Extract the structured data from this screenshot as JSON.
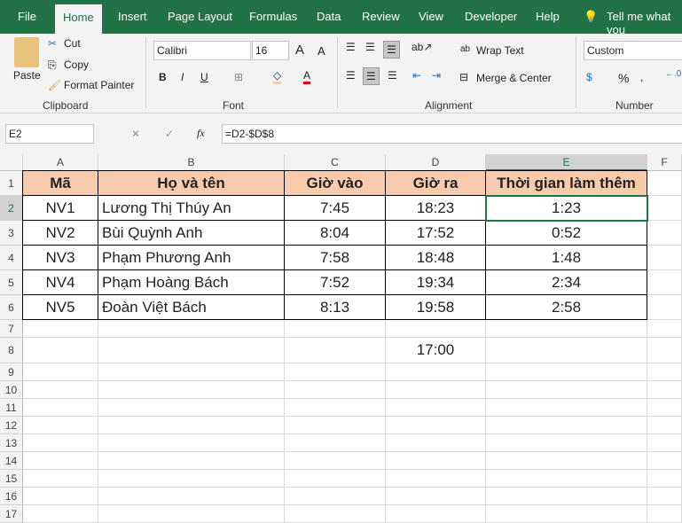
{
  "tabs": [
    "File",
    "Home",
    "Insert",
    "Page Layout",
    "Formulas",
    "Data",
    "Review",
    "View",
    "Developer",
    "Help"
  ],
  "tell_me": "Tell me what you",
  "clipboard": {
    "paste": "Paste",
    "cut": "Cut",
    "copy": "Copy",
    "format_painter": "Format Painter",
    "label": "Clipboard"
  },
  "font": {
    "name": "Calibri",
    "size": "16",
    "label": "Font"
  },
  "alignment": {
    "wrap": "Wrap Text",
    "merge": "Merge & Center",
    "label": "Alignment"
  },
  "number": {
    "format": "Custom",
    "label": "Number"
  },
  "formula_bar": {
    "name_box": "E2",
    "formula": "=D2-$D$8",
    "fx": "fx"
  },
  "columns": [
    "A",
    "B",
    "C",
    "D",
    "E",
    "F"
  ],
  "rows": [
    "1",
    "2",
    "3",
    "4",
    "5",
    "6",
    "7",
    "8",
    "9",
    "10",
    "11",
    "12",
    "13",
    "14",
    "15",
    "16",
    "17"
  ],
  "table": {
    "headers": [
      "Mã",
      "Họ và tên",
      "Giờ vào",
      "Giờ ra",
      "Thời gian làm thêm"
    ],
    "rows": [
      [
        "NV1",
        "Lương Thị Thúy An",
        "7:45",
        "18:23",
        "1:23"
      ],
      [
        "NV2",
        "Bùi Quỳnh Anh",
        "8:04",
        "17:52",
        "0:52"
      ],
      [
        "NV3",
        "Phạm Phương Anh",
        "7:58",
        "18:48",
        "1:48"
      ],
      [
        "NV4",
        "Phạm Hoàng Bách",
        "7:52",
        "19:34",
        "2:34"
      ],
      [
        "NV5",
        "Đoàn Việt Bách",
        "8:13",
        "19:58",
        "2:58"
      ]
    ]
  },
  "d8": "17:00"
}
